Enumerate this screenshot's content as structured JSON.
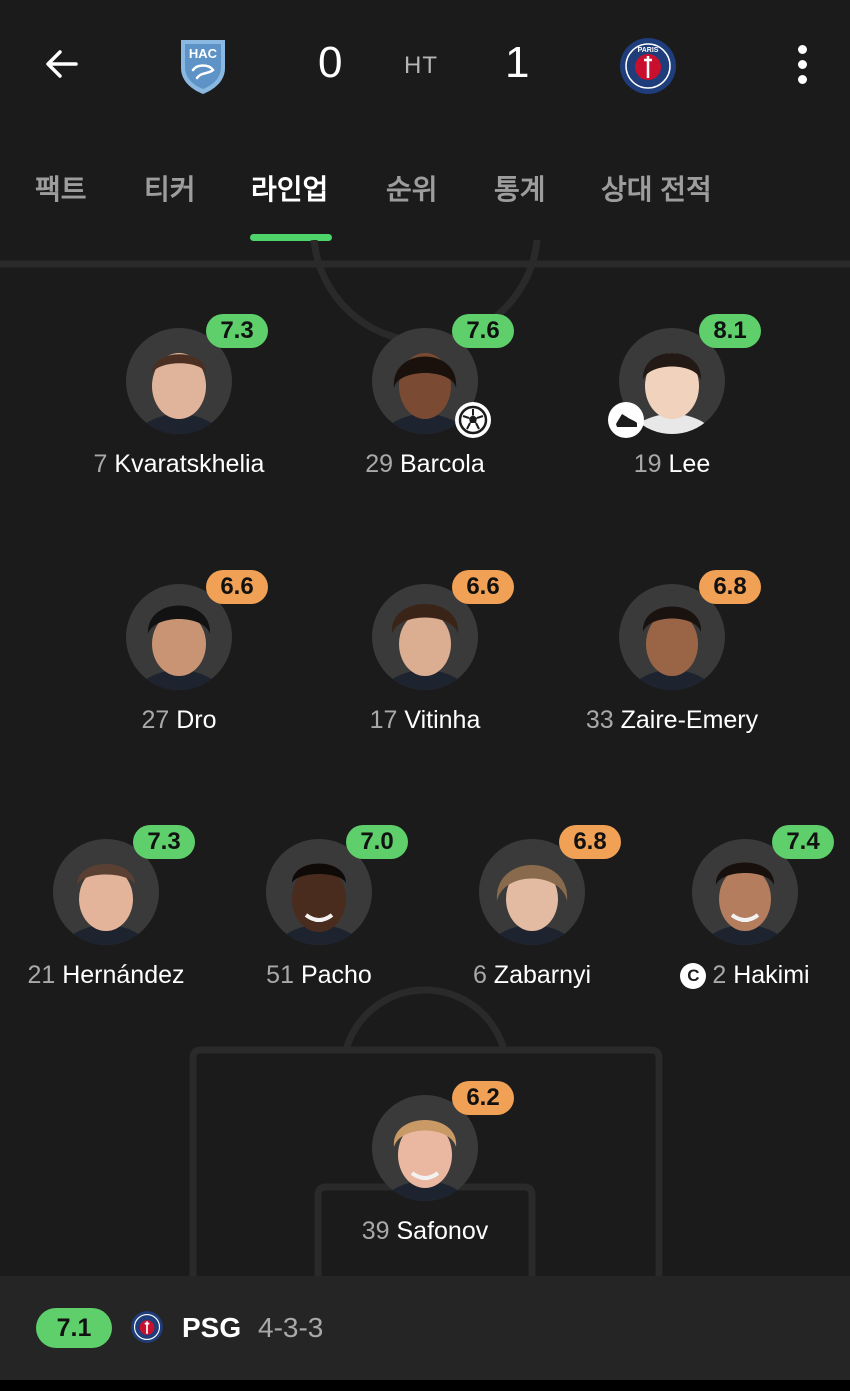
{
  "header": {
    "home_team": "HAC",
    "home_score": "0",
    "status": "HT",
    "away_score": "1",
    "away_team": "PARIS"
  },
  "tabs": [
    {
      "label": "팩트",
      "active": false
    },
    {
      "label": "티커",
      "active": false
    },
    {
      "label": "라인업",
      "active": true
    },
    {
      "label": "순위",
      "active": false
    },
    {
      "label": "통계",
      "active": false
    },
    {
      "label": "상대 전적",
      "active": false
    }
  ],
  "colors": {
    "rating_high": "#5ecf6b",
    "rating_mid": "#f0a155",
    "accent": "#4fd36b",
    "background": "#1b1b1b"
  },
  "lineup": {
    "forwards": [
      {
        "number": "7",
        "name": "Kvaratskhelia",
        "rating": "7.3",
        "rating_level": "green"
      },
      {
        "number": "29",
        "name": "Barcola",
        "rating": "7.6",
        "rating_level": "green",
        "event_icon": "goal-ball-icon"
      },
      {
        "number": "19",
        "name": "Lee",
        "rating": "8.1",
        "rating_level": "green",
        "event_icon": "assist-boot-icon"
      }
    ],
    "midfielders": [
      {
        "number": "27",
        "name": "Dro",
        "rating": "6.6",
        "rating_level": "orange"
      },
      {
        "number": "17",
        "name": "Vitinha",
        "rating": "6.6",
        "rating_level": "orange"
      },
      {
        "number": "33",
        "name": "Zaire-Emery",
        "rating": "6.8",
        "rating_level": "orange"
      }
    ],
    "defenders": [
      {
        "number": "21",
        "name": "Hernández",
        "rating": "7.3",
        "rating_level": "green"
      },
      {
        "number": "51",
        "name": "Pacho",
        "rating": "7.0",
        "rating_level": "green"
      },
      {
        "number": "6",
        "name": "Zabarnyi",
        "rating": "6.8",
        "rating_level": "orange"
      },
      {
        "number": "2",
        "name": "Hakimi",
        "rating": "7.4",
        "rating_level": "green",
        "captain": "C"
      }
    ],
    "goalkeeper": {
      "number": "39",
      "name": "Safonov",
      "rating": "6.2",
      "rating_level": "orange"
    }
  },
  "footer": {
    "team_rating": "7.1",
    "team_name": "PSG",
    "formation": "4-3-3"
  }
}
